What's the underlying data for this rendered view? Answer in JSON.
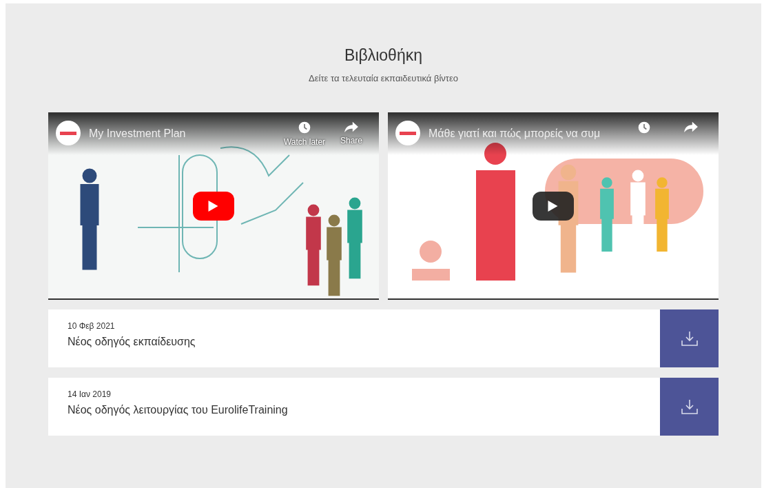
{
  "header": {
    "title": "Βιβλιοθήκη",
    "subtitle": "Δείτε τα τελευταία εκπαιδευτικά βίντεο"
  },
  "videos": [
    {
      "title": "My Investment Plan",
      "kind": "questions",
      "actions": [
        {
          "kind": "watch_later",
          "label": "Watch later"
        },
        {
          "kind": "share",
          "label": "Share"
        }
      ]
    },
    {
      "title": "Μάθε γιατί και πώς μπορείς να συμ",
      "kind": "bars",
      "actions": [
        {
          "kind": "watch_later"
        },
        {
          "kind": "share"
        }
      ]
    }
  ],
  "documents": [
    {
      "date": "10 Φεβ 2021",
      "title": "Νέος οδηγός εκπαίδευσης"
    },
    {
      "date": "14 Ιαν 2019",
      "title": "Νέος οδηγός λειτουργίας του EurolifeTraining"
    }
  ]
}
